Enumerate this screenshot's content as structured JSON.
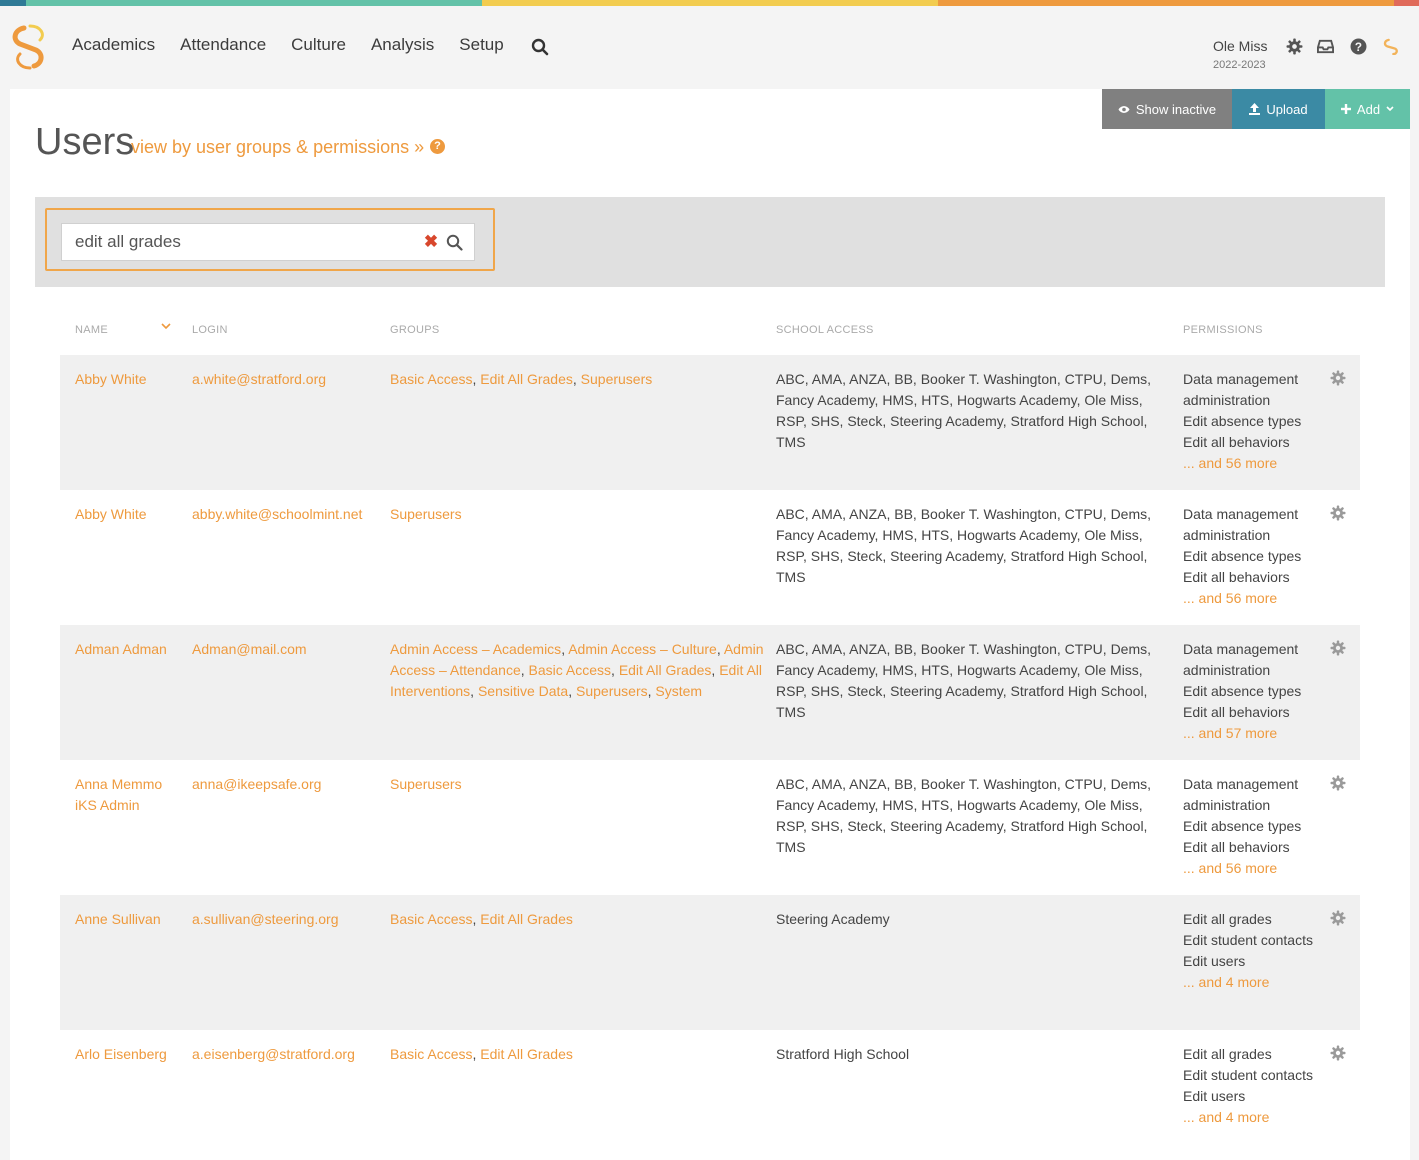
{
  "colors": {
    "accent": "#ee9a3e",
    "teal": "#3b8aa4",
    "mint": "#63c2a8",
    "yellow": "#f2cc4f",
    "clear": "#d8472c"
  },
  "nav": {
    "items": [
      "Academics",
      "Attendance",
      "Culture",
      "Analysis",
      "Setup"
    ],
    "search_icon": "search-icon"
  },
  "school": {
    "name": "Ole Miss",
    "year": "2022-2023"
  },
  "toolbar": {
    "show_inactive": "Show inactive",
    "upload": "Upload",
    "add": "Add"
  },
  "page": {
    "title": "Users",
    "permissions_link": "view by user groups & permissions »",
    "help": "?"
  },
  "search": {
    "value": "edit all grades",
    "clear": "✖"
  },
  "table": {
    "headers": {
      "name": "NAME",
      "login": "LOGIN",
      "groups": "GROUPS",
      "school_access": "SCHOOL ACCESS",
      "permissions": "PERMISSIONS"
    },
    "rows": [
      {
        "name": "Abby White",
        "login": "a.white@stratford.org",
        "groups": [
          "Basic Access",
          "Edit All Grades",
          "Superusers"
        ],
        "school_access": "ABC, AMA, ANZA, BB, Booker T. Washington, CTPU, Dems, Fancy Academy, HMS, HTS, Hogwarts Academy, Ole Miss, RSP, SHS, Steck, Steering Academy, Stratford High School, TMS",
        "permissions": [
          "Data management administration",
          "Edit absence types",
          "Edit all behaviors"
        ],
        "more": "... and 56 more"
      },
      {
        "name": "Abby White",
        "login": "abby.white@schoolmint.net",
        "groups": [
          "Superusers"
        ],
        "school_access": "ABC, AMA, ANZA, BB, Booker T. Washington, CTPU, Dems, Fancy Academy, HMS, HTS, Hogwarts Academy, Ole Miss, RSP, SHS, Steck, Steering Academy, Stratford High School, TMS",
        "permissions": [
          "Data management administration",
          "Edit absence types",
          "Edit all behaviors"
        ],
        "more": "... and 56 more"
      },
      {
        "name": "Adman Adman",
        "login": "Adman@mail.com",
        "groups": [
          "Admin Access – Academics",
          "Admin Access – Culture",
          "Admin Access – Attendance",
          "Basic Access",
          "Edit All Grades",
          "Edit All Interventions",
          "Sensitive Data",
          "Superusers",
          "System"
        ],
        "school_access": "ABC, AMA, ANZA, BB, Booker T. Washington, CTPU, Dems, Fancy Academy, HMS, HTS, Hogwarts Academy, Ole Miss, RSP, SHS, Steck, Steering Academy, Stratford High School, TMS",
        "permissions": [
          "Data management administration",
          "Edit absence types",
          "Edit all behaviors"
        ],
        "more": "... and 57 more"
      },
      {
        "name": "Anna Memmo iKS Admin",
        "login": "anna@ikeepsafe.org",
        "groups": [
          "Superusers"
        ],
        "school_access": "ABC, AMA, ANZA, BB, Booker T. Washington, CTPU, Dems, Fancy Academy, HMS, HTS, Hogwarts Academy, Ole Miss, RSP, SHS, Steck, Steering Academy, Stratford High School, TMS",
        "permissions": [
          "Data management administration",
          "Edit absence types",
          "Edit all behaviors"
        ],
        "more": "... and 56 more"
      },
      {
        "name": "Anne Sullivan",
        "login": "a.sullivan@steering.org",
        "groups": [
          "Basic Access",
          "Edit All Grades"
        ],
        "school_access": "Steering Academy",
        "permissions": [
          "Edit all grades",
          "Edit student contacts",
          "Edit users"
        ],
        "more": "... and 4 more"
      },
      {
        "name": "Arlo Eisenberg",
        "login": "a.eisenberg@stratford.org",
        "groups": [
          "Basic Access",
          "Edit All Grades"
        ],
        "school_access": "Stratford High School",
        "permissions": [
          "Edit all grades",
          "Edit student contacts",
          "Edit users"
        ],
        "more": "... and 4 more"
      }
    ]
  }
}
